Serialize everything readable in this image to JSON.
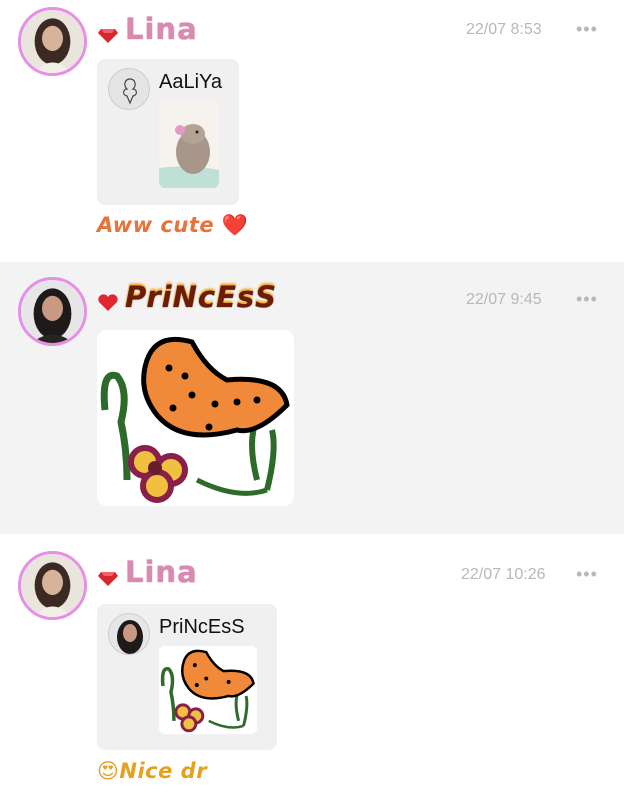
{
  "posts": [
    {
      "author": "Lina",
      "time": "22/07 8:53",
      "more": "•••",
      "quote": {
        "author": "AaLiYa"
      },
      "caption": "Aww cute",
      "caption_emoji": "❤️"
    },
    {
      "author": "PriNcEsS",
      "time": "22/07 9:45",
      "more": "•••"
    },
    {
      "author": "Lina",
      "time": "22/07 10:26",
      "more": "•••",
      "quote": {
        "author": "PriNcEsS"
      },
      "caption_emoji": "😍",
      "caption": "Nice dr"
    }
  ],
  "colors": {
    "avatar_ring": "#e58fe6",
    "alt_background": "#f3f3f3",
    "caption_1": "#e8733a",
    "caption_2": "#e6a020"
  },
  "icons": {
    "post_1_badge": "ruby-gem-icon",
    "post_2_badge": "heart-icon",
    "post_3_badge": "ruby-gem-icon",
    "more": "more-horizontal-icon"
  }
}
